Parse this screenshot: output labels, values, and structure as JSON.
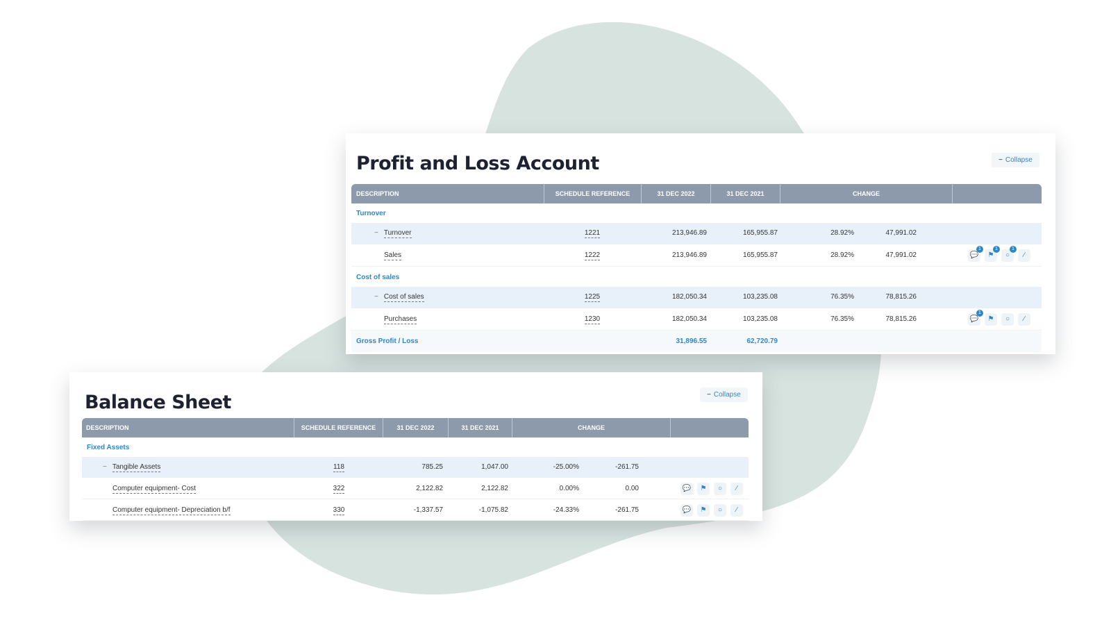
{
  "colors": {
    "accent": "#2f86c6",
    "header_bg": "#8d9aac",
    "highlight_row": "#e8f1fa",
    "blob": "#d7e3df"
  },
  "pl": {
    "title": "Profit and Loss Account",
    "collapse_label": "Collapse",
    "columns": [
      "DESCRIPTION",
      "SCHEDULE REFERENCE",
      "31 DEC 2022",
      "31 DEC 2021",
      "CHANGE"
    ],
    "sections": [
      {
        "label": "Turnover",
        "rows": [
          {
            "desc": "Turnover",
            "ref": "1221",
            "y2022": "213,946.89",
            "y2021": "165,955.87",
            "pct": "28.92%",
            "diff": "47,991.02",
            "collapsible": true,
            "highlight": true
          },
          {
            "desc": "Sales",
            "ref": "1222",
            "y2022": "213,946.89",
            "y2021": "165,955.87",
            "pct": "28.92%",
            "diff": "47,991.02",
            "icons": [
              "comments-icon",
              "flag-icon",
              "chat-icon",
              "attachment-icon"
            ],
            "badges": [
              "1",
              "1",
              "1",
              ""
            ]
          }
        ]
      },
      {
        "label": "Cost of sales",
        "rows": [
          {
            "desc": "Cost of sales",
            "ref": "1225",
            "y2022": "182,050.34",
            "y2021": "103,235.08",
            "pct": "76.35%",
            "diff": "78,815.26",
            "collapsible": true,
            "highlight": true
          },
          {
            "desc": "Purchases",
            "ref": "1230",
            "y2022": "182,050.34",
            "y2021": "103,235.08",
            "pct": "76.35%",
            "diff": "78,815.26",
            "icons": [
              "comments-icon",
              "flag-icon",
              "chat-icon",
              "attachment-icon"
            ],
            "badges": [
              "1",
              "",
              "",
              ""
            ]
          }
        ]
      }
    ],
    "total": {
      "label": "Gross Profit / Loss",
      "y2022": "31,896.55",
      "y2021": "62,720.79"
    }
  },
  "bs": {
    "title": "Balance Sheet",
    "collapse_label": "Collapse",
    "columns": [
      "DESCRIPTION",
      "SCHEDULE REFERENCE",
      "31 DEC 2022",
      "31 DEC 2021",
      "CHANGE"
    ],
    "sections": [
      {
        "label": "Fixed Assets",
        "rows": [
          {
            "desc": "Tangible Assets",
            "ref": "118",
            "y2022": "785.25",
            "y2021": "1,047.00",
            "pct": "-25.00%",
            "diff": "-261.75",
            "collapsible": true,
            "highlight": true
          },
          {
            "desc": "Computer equipment- Cost",
            "ref": "322",
            "y2022": "2,122.82",
            "y2021": "2,122.82",
            "pct": "0.00%",
            "diff": "0.00",
            "icons": [
              "comments-icon",
              "flag-icon",
              "chat-icon",
              "attachment-icon"
            ],
            "badges": [
              "",
              "",
              "",
              ""
            ]
          },
          {
            "desc": "Computer equipment- Depreciation b/f",
            "ref": "330",
            "y2022": "-1,337.57",
            "y2021": "-1,075.82",
            "pct": "-24.33%",
            "diff": "-261.75",
            "icons": [
              "comments-icon",
              "flag-icon",
              "chat-icon",
              "attachment-icon"
            ],
            "badges": [
              "",
              "",
              "",
              ""
            ]
          }
        ]
      }
    ]
  }
}
